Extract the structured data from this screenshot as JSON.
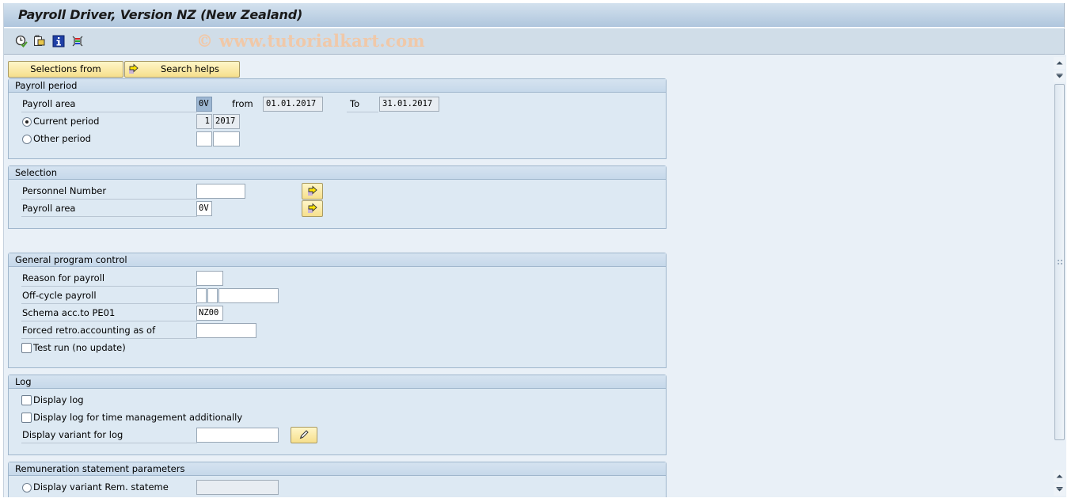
{
  "window": {
    "title": "Payroll Driver, Version NZ (New Zealand)",
    "watermark": "© www.tutorialkart.com"
  },
  "toolbar": {
    "icons": [
      "execute-background-icon",
      "get-variant-icon",
      "program-documentation-icon",
      "selection-options-icon"
    ]
  },
  "buttons": {
    "selections_from": "Selections from",
    "search_helps": "Search helps"
  },
  "payroll_period": {
    "header": "Payroll period",
    "payroll_area_label": "Payroll area",
    "payroll_area_value": "0V",
    "from_label": "from",
    "from_value": "01.01.2017",
    "to_label": "To",
    "to_value": "31.01.2017",
    "current_period_label": "Current period",
    "current_period_selected": true,
    "current_period_number": "1",
    "current_period_year": "2017",
    "other_period_label": "Other period",
    "other_period_selected": false,
    "other_period_number": "",
    "other_period_year": ""
  },
  "selection": {
    "header": "Selection",
    "personnel_number_label": "Personnel Number",
    "personnel_number_value": "",
    "payroll_area_label": "Payroll area",
    "payroll_area_value": "0V"
  },
  "general_program_control": {
    "header": "General program control",
    "reason_label": "Reason for payroll",
    "reason_value": "",
    "offcycle_label": "Off-cycle payroll",
    "offcycle_values": [
      "",
      "",
      ""
    ],
    "schema_label": "Schema acc.to PE01",
    "schema_value": "NZ00",
    "forced_retro_label": "Forced retro.accounting as of",
    "forced_retro_value": "",
    "test_run_label": "Test run (no update)",
    "test_run_checked": false
  },
  "log": {
    "header": "Log",
    "display_log_label": "Display log",
    "display_log_checked": false,
    "display_log_time_label": "Display log for time management additionally",
    "display_log_time_checked": false,
    "display_variant_label": "Display variant for log",
    "display_variant_value": ""
  },
  "remuneration": {
    "header": "Remuneration statement parameters",
    "display_variant_label": "Display variant Rem. stateme",
    "display_variant_selected": false,
    "display_variant_value": ""
  }
}
